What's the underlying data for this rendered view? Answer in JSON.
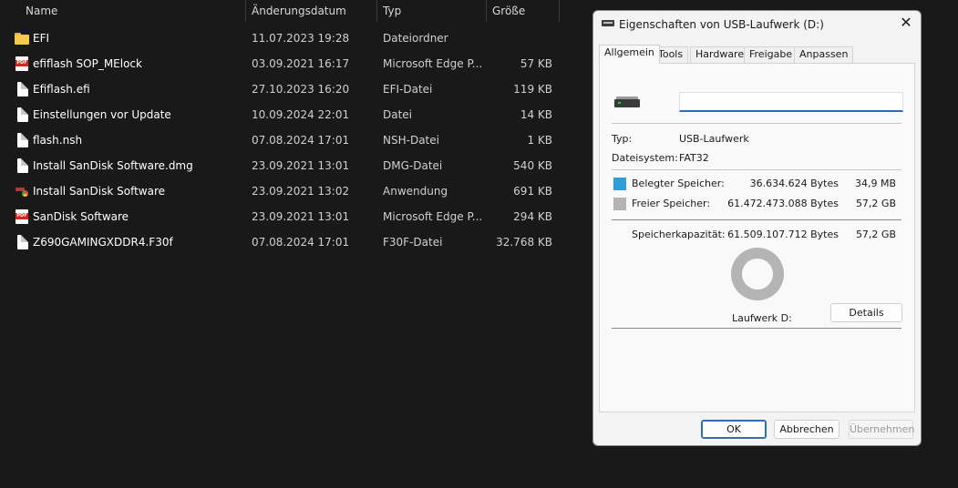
{
  "explorer": {
    "columns": {
      "name": "Name",
      "date": "Änderungsdatum",
      "type": "Typ",
      "size": "Größe"
    },
    "files": [
      {
        "icon": "folder-icon",
        "name": "EFI",
        "date": "11.07.2023 19:28",
        "type": "Dateiordner",
        "size": ""
      },
      {
        "icon": "pdf-icon",
        "name": "efiflash SOP_MElock",
        "date": "03.09.2021 16:17",
        "type": "Microsoft Edge P...",
        "size": "57 KB"
      },
      {
        "icon": "file-icon",
        "name": "Efiflash.efi",
        "date": "27.10.2023 16:20",
        "type": "EFI-Datei",
        "size": "119 KB"
      },
      {
        "icon": "file-icon",
        "name": "Einstellungen vor Update",
        "date": "10.09.2024 22:01",
        "type": "Datei",
        "size": "14 KB"
      },
      {
        "icon": "file-icon",
        "name": "flash.nsh",
        "date": "07.08.2024 17:01",
        "type": "NSH-Datei",
        "size": "1 KB"
      },
      {
        "icon": "file-icon",
        "name": "Install SanDisk Software.dmg",
        "date": "23.09.2021 13:01",
        "type": "DMG-Datei",
        "size": "540 KB"
      },
      {
        "icon": "app-icon",
        "name": "Install SanDisk Software",
        "date": "23.09.2021 13:02",
        "type": "Anwendung",
        "size": "691 KB"
      },
      {
        "icon": "pdf-icon",
        "name": "SanDisk Software",
        "date": "23.09.2021 13:01",
        "type": "Microsoft Edge P...",
        "size": "294 KB"
      },
      {
        "icon": "file-icon",
        "name": "Z690GAMINGXDDR4.F30f",
        "date": "07.08.2024 17:01",
        "type": "F30F-Datei",
        "size": "32.768 KB"
      }
    ]
  },
  "dialog": {
    "title": "Eigenschaften von USB-Laufwerk (D:)",
    "close_glyph": "✕",
    "tabs": [
      "Allgemein",
      "Tools",
      "Hardware",
      "Freigabe",
      "Anpassen"
    ],
    "active_tab": "Allgemein",
    "volume_label": "",
    "type_label": "Typ:",
    "type_value": "USB-Laufwerk",
    "fs_label": "Dateisystem:",
    "fs_value": "FAT32",
    "used_label": "Belegter Speicher:",
    "used_bytes": "36.634.624 Bytes",
    "used_human": "34,9 MB",
    "free_label": "Freier Speicher:",
    "free_bytes": "61.472.473.088 Bytes",
    "free_human": "57,2 GB",
    "capacity_label": "Speicherkapazität:",
    "capacity_bytes": "61.509.107.712 Bytes",
    "capacity_human": "57,2 GB",
    "drive_label": "Laufwerk D:",
    "details_button": "Details",
    "ok_button": "OK",
    "cancel_button": "Abbrechen",
    "apply_button": "Übernehmen",
    "used_fraction": 0.0006,
    "colors": {
      "used": "#2b9fd9",
      "free": "#b4b4b4",
      "accent": "#2f6db5"
    }
  }
}
